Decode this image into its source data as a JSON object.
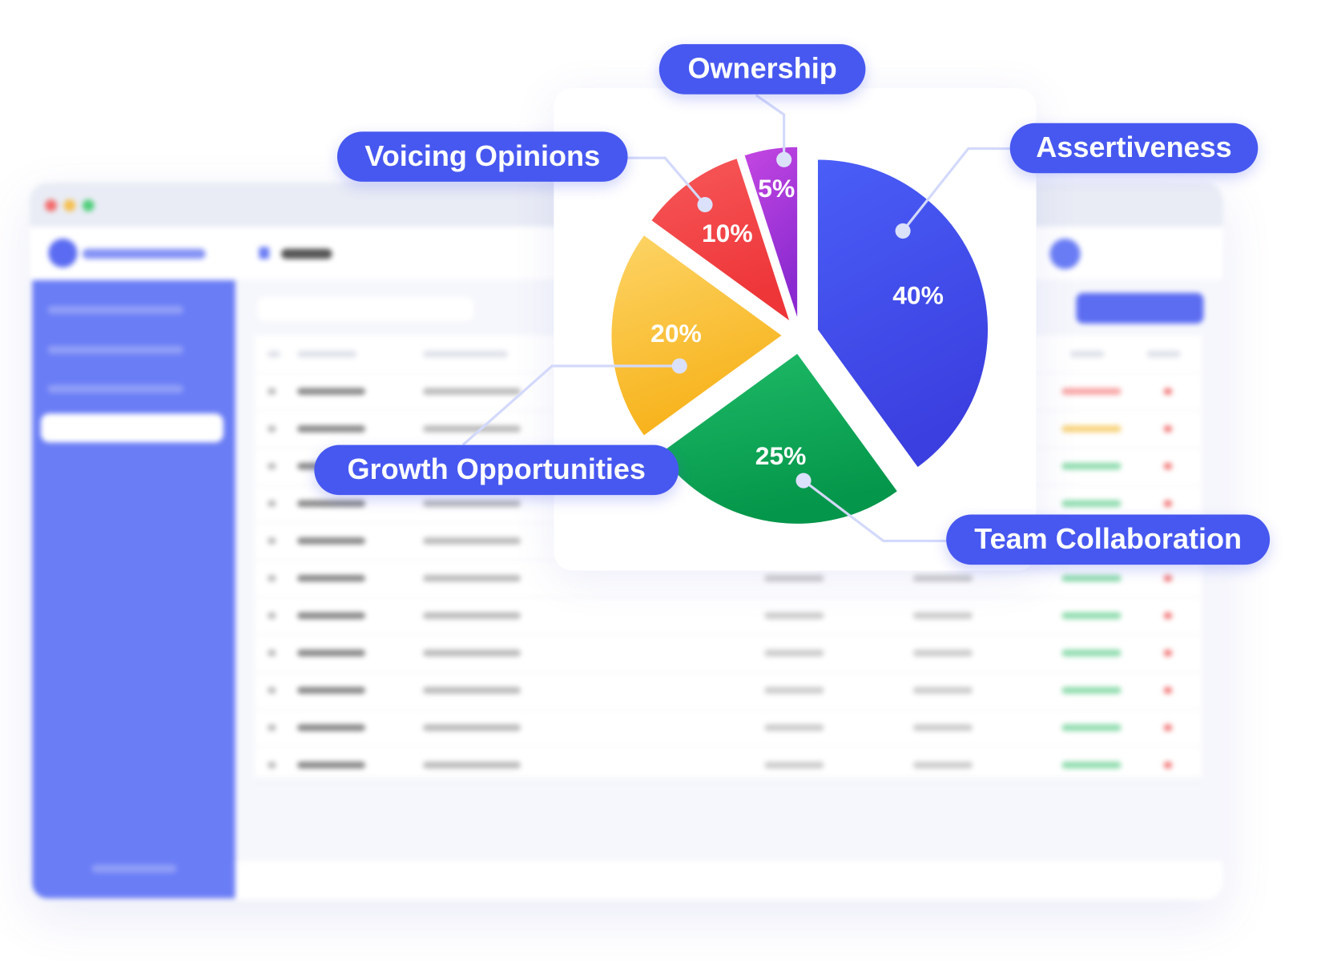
{
  "chart_data": {
    "type": "pie",
    "categories": [
      "Assertiveness",
      "Team Collaboration",
      "Growth Opportunities",
      "Voicing Opinions",
      "Ownership"
    ],
    "values": [
      40,
      25,
      20,
      10,
      5
    ],
    "data_labels": [
      "40%",
      "25%",
      "20%",
      "10%",
      "5%"
    ],
    "colors": [
      "#4353ee",
      "#14a957",
      "#fbc02d",
      "#f2434a",
      "#b23ad8"
    ],
    "exploded": true,
    "legend": "callout-labels"
  },
  "background_app": {
    "blurred": true,
    "accent": "#6a7df5",
    "window_controls": [
      "#f36b6b",
      "#f6c04f",
      "#4fce7a"
    ]
  }
}
